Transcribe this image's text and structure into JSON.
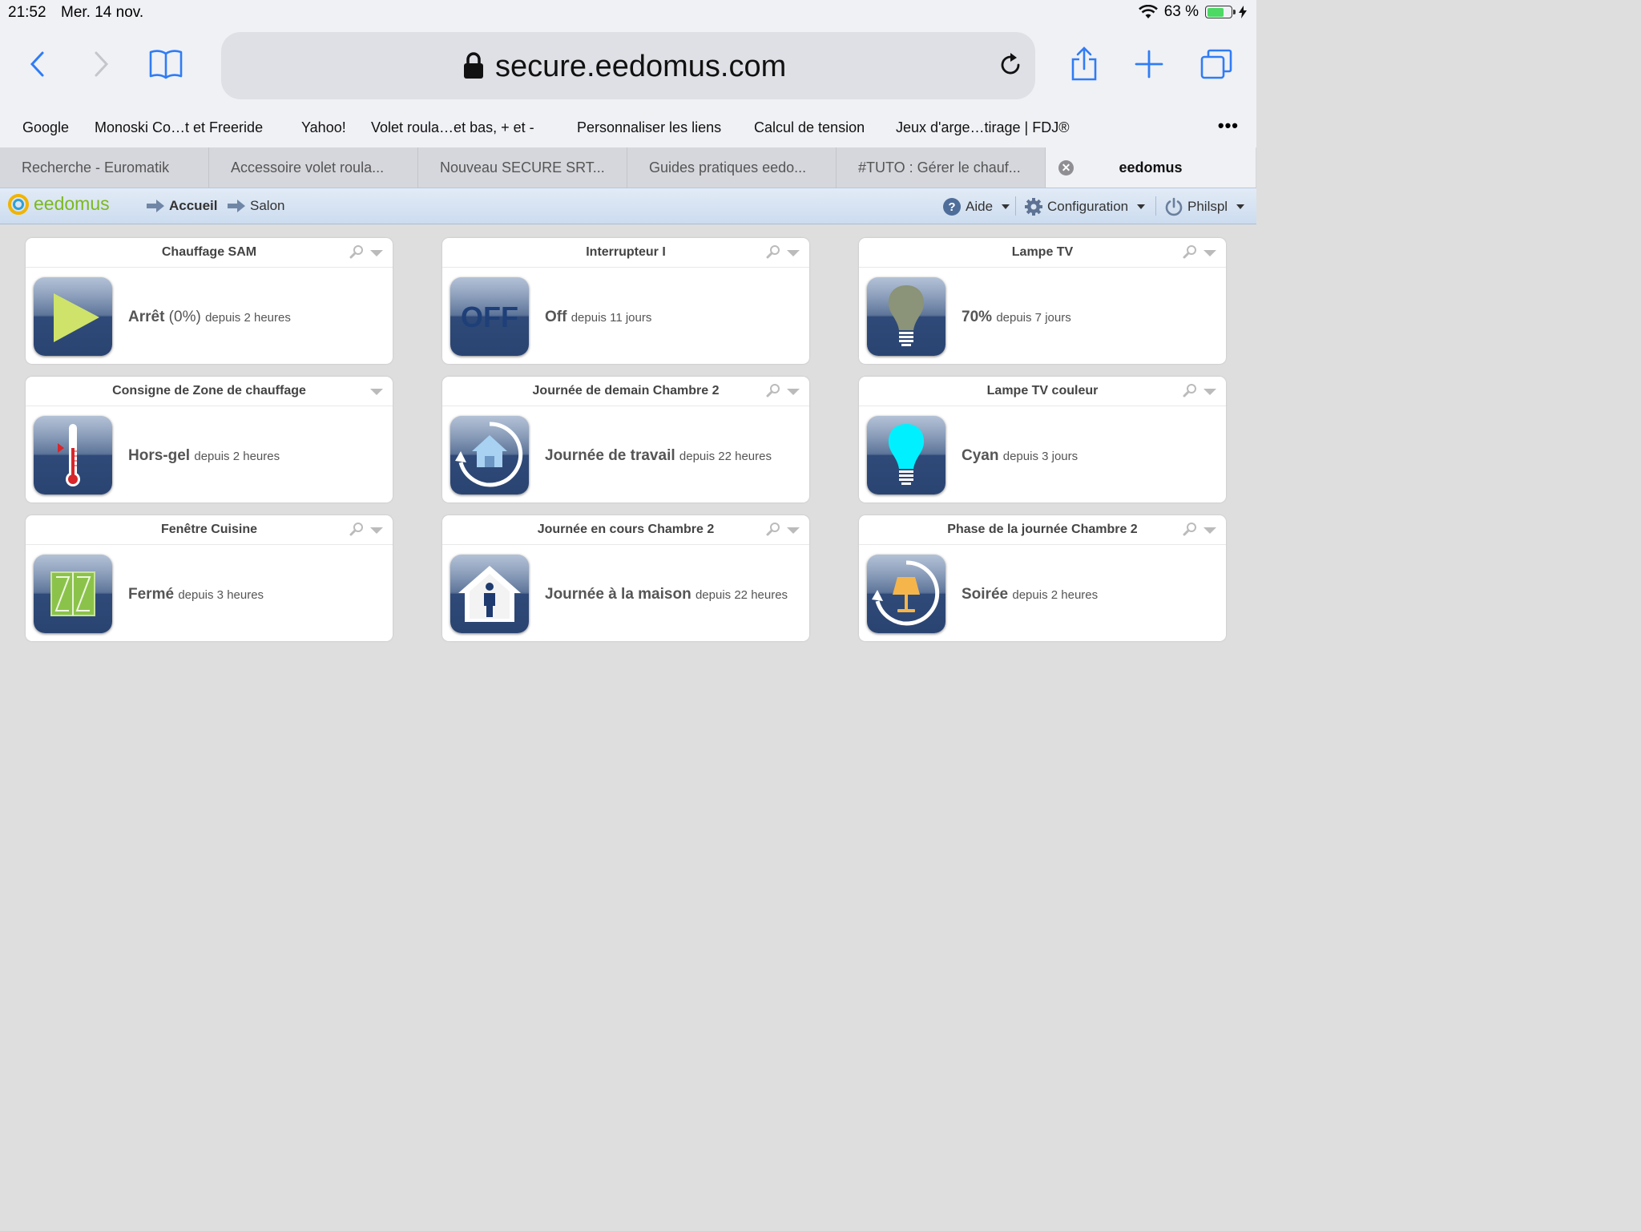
{
  "status": {
    "time": "21:52",
    "date": "Mer. 14 nov.",
    "battery": "63 %",
    "battery_level": 0.63
  },
  "browser": {
    "url": "secure.eedomus.com"
  },
  "bookmarks": [
    "Google",
    "Monoski Co…t et Freeride",
    "Yahoo!",
    "Volet roula…et bas, + et -",
    "Personnaliser les liens",
    "Calcul de tension",
    "Jeux d'arge…tirage | FDJ®"
  ],
  "tabs": [
    "Recherche - Euromatik",
    "Accessoire volet roula...",
    "Nouveau SECURE SRT...",
    "Guides pratiques eedo...",
    "#TUTO : Gérer le chauf...",
    "eedomus"
  ],
  "app": {
    "logo": "eedomus",
    "breadcrumb": [
      "Accueil",
      "Salon"
    ],
    "menu": {
      "help": "Aide",
      "config": "Configuration",
      "user": "Philspl"
    }
  },
  "widgets": [
    {
      "title": "Chauffage SAM",
      "value": "Arrêt",
      "extra": " (0%)",
      "since": "depuis 2 heures",
      "icon": "play-icon"
    },
    {
      "title": "Interrupteur I",
      "value": "Off",
      "extra": "",
      "since": "depuis 11 jours",
      "icon": "off-icon",
      "icon_text": "OFF"
    },
    {
      "title": "Lampe TV",
      "value": "70%",
      "extra": "",
      "since": "depuis 7 jours",
      "icon": "bulb-icon"
    },
    {
      "title": "Consigne de Zone de chauffage",
      "value": "Hors-gel",
      "extra": "",
      "since": "depuis 2 heures",
      "icon": "thermometer-icon"
    },
    {
      "title": "Journée de demain Chambre 2",
      "value": "Journée de travail",
      "extra": "",
      "since": "depuis 22 heures",
      "icon": "house-cycle-icon"
    },
    {
      "title": "Lampe TV couleur",
      "value": "Cyan",
      "extra": "",
      "since": "depuis 3 jours",
      "icon": "cyan-bulb-icon"
    },
    {
      "title": "Fenêtre Cuisine",
      "value": "Fermé",
      "extra": "",
      "since": "depuis 3 heures",
      "icon": "window-icon"
    },
    {
      "title": "Journée en cours Chambre 2",
      "value": "Journée à la maison",
      "extra": "",
      "since": "depuis 22 heures",
      "icon": "house-person-icon"
    },
    {
      "title": "Phase de la journée Chambre 2",
      "value": "Soirée",
      "extra": "",
      "since": "depuis 2 heures",
      "icon": "lamp-cycle-icon"
    }
  ]
}
